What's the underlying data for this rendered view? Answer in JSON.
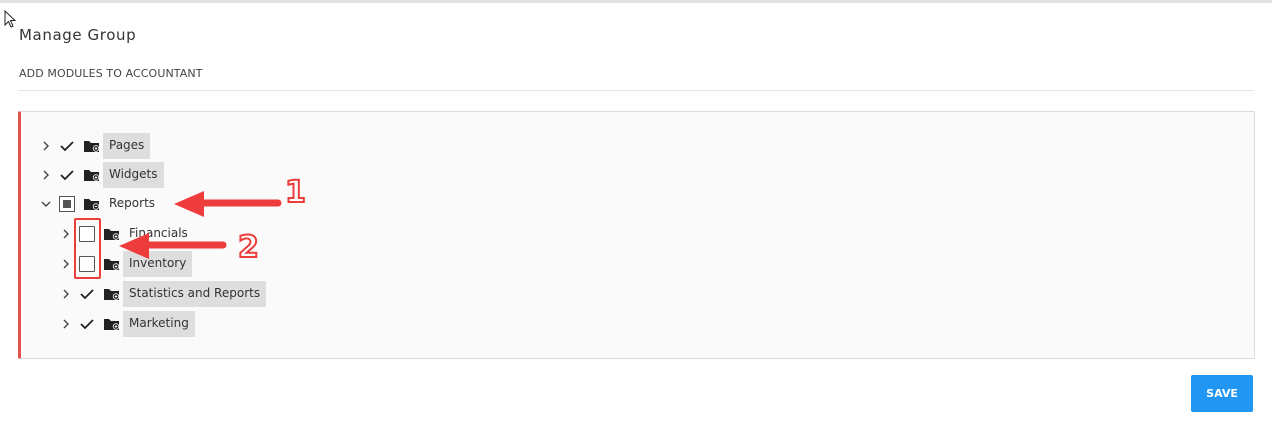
{
  "page": {
    "title": "Manage Group",
    "subtitle": "ADD MODULES TO ACCOUNTANT"
  },
  "tree": {
    "nodes": [
      {
        "label": "Pages",
        "state": "checked",
        "expanded": false,
        "level": 0
      },
      {
        "label": "Widgets",
        "state": "checked",
        "expanded": false,
        "level": 0
      },
      {
        "label": "Reports",
        "state": "partial",
        "expanded": true,
        "level": 0
      },
      {
        "label": "Financials",
        "state": "unchecked",
        "expanded": false,
        "level": 1
      },
      {
        "label": "Inventory",
        "state": "unchecked",
        "expanded": false,
        "level": 1
      },
      {
        "label": "Statistics and Reports",
        "state": "checked",
        "expanded": false,
        "level": 1
      },
      {
        "label": "Marketing",
        "state": "checked",
        "expanded": false,
        "level": 1
      }
    ]
  },
  "actions": {
    "save_label": "SAVE"
  },
  "annotations": {
    "marker_1": "1",
    "marker_2": "2"
  },
  "colors": {
    "accent": "#2196f3",
    "annotation": "#ee3b3b",
    "tree_border": "#e2534b"
  }
}
